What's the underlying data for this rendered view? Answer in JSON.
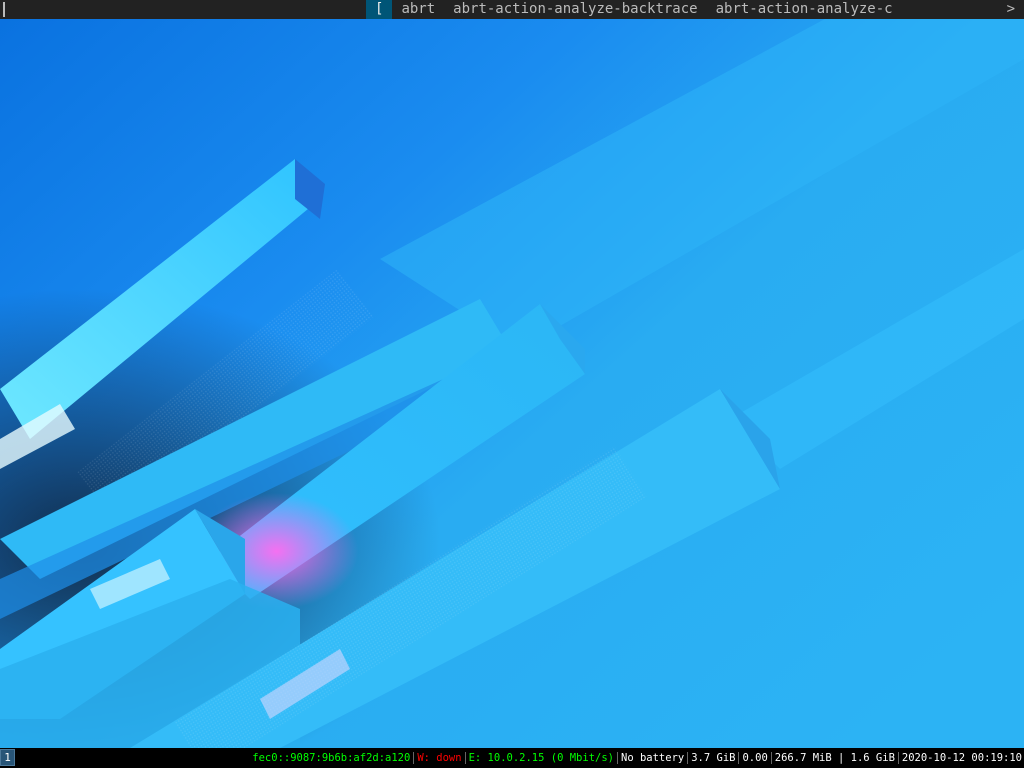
{
  "dmenu": {
    "prompt_value": "",
    "items": [
      {
        "label": "[",
        "selected": true
      },
      {
        "label": "abrt",
        "selected": false
      },
      {
        "label": "abrt-action-analyze-backtrace",
        "selected": false
      },
      {
        "label": "abrt-action-analyze-c",
        "selected": false
      }
    ],
    "more_indicator": ">"
  },
  "colors": {
    "bar_bg": "#222222",
    "bar_fg": "#bbbbbb",
    "selected_bg": "#005577",
    "status_good": "#00ff00",
    "status_bad": "#ff0000",
    "status_normal": "#ffffff",
    "workspace_focused_bg": "#285577"
  },
  "statusbar": {
    "workspaces": [
      {
        "label": "1",
        "focused": true
      }
    ],
    "ipv6": "fec0::9087:9b6b:af2d:a120",
    "wireless": "W: down",
    "ethernet": "E: 10.0.2.15 (0 Mbit/s)",
    "battery": "No battery",
    "disk": "3.7 GiB",
    "load": "0.00",
    "memory": "266.7 MiB | 1.6 GiB",
    "datetime": "2020-10-12 00:19:10"
  }
}
